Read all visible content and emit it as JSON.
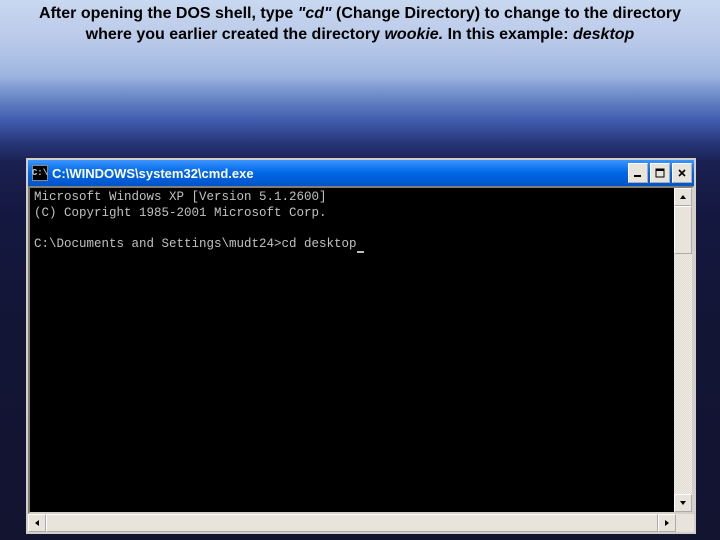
{
  "instruction": {
    "prefix": "After opening the DOS shell, type ",
    "cmd": "\"cd\"",
    "mid1": " (Change Directory)  to change to the directory where you earlier created the directory ",
    "dir": "wookie.",
    "mid2": " In this example: ",
    "example": "desktop"
  },
  "window": {
    "icon_label": "C:\\",
    "title": "C:\\WINDOWS\\system32\\cmd.exe"
  },
  "console": {
    "line1": "Microsoft Windows XP [Version 5.1.2600]",
    "line2": "(C) Copyright 1985-2001 Microsoft Corp.",
    "blank": "",
    "prompt": "C:\\Documents and Settings\\mudt24>cd desktop"
  }
}
